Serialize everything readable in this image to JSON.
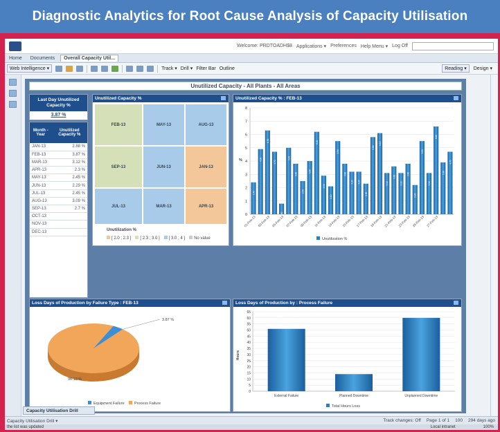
{
  "banner": {
    "title": "Diagnostic Analytics for Root Cause Analysis of Capacity Utilisation"
  },
  "topbar": {
    "welcome": "Welcome: PRDTOADH$8",
    "applications": "Applications ▾",
    "preferences": "Preferences",
    "help": "Help Menu ▾",
    "logoff": "Log Off"
  },
  "tabs": [
    {
      "label": "Home"
    },
    {
      "label": "Documents"
    },
    {
      "label": "Overall Capacity Util..."
    }
  ],
  "toolbar": {
    "nav": "Web Intelligence ▾",
    "track": "Track ▾",
    "drill": "Drill ▾",
    "filterbar": "Filter Bar",
    "outline": "Outline",
    "reading": "Reading ▾",
    "design": "Design ▾"
  },
  "report": {
    "title": "Unutilized Capacity - All Plants - All Areas"
  },
  "lastday": {
    "header": "Last Day Unutilized Capacity %",
    "value": "3.87 %"
  },
  "month_table": {
    "col_month": "Month - Year",
    "col_value": "Unutilized Capacity %",
    "rows": [
      {
        "month": "JAN-13",
        "value": "2.88 %"
      },
      {
        "month": "FEB-13",
        "value": "3.87 %"
      },
      {
        "month": "MAR-13",
        "value": "3.12 %"
      },
      {
        "month": "APR-13",
        "value": "2.3 %"
      },
      {
        "month": "MAY-13",
        "value": "2.45 %"
      },
      {
        "month": "JUN-13",
        "value": "2.29 %"
      },
      {
        "month": "JUL-13",
        "value": "2.45 %"
      },
      {
        "month": "AUG-13",
        "value": "3.09 %"
      },
      {
        "month": "SEP-13",
        "value": "2.7 %"
      },
      {
        "month": "OCT-13",
        "value": ""
      },
      {
        "month": "NOV-13",
        "value": ""
      },
      {
        "month": "DEC-13",
        "value": ""
      }
    ]
  },
  "heatmap": {
    "header": "Unutilized Capacity %",
    "cells": [
      "FEB-13",
      "MAY-13",
      "AUG-13",
      "SEP-13",
      "JUN-13",
      "JAN-13",
      "JUL-13",
      "MAR-13",
      "APR-13"
    ],
    "legend_title": "Unutilization %",
    "legend": [
      "[ 2.0 ; 2.3 ]",
      "[ 2.3 ; 3.0 ]",
      "[ 3.0 ; 4 ]",
      "No value"
    ],
    "colors": {
      "low": "#f4c79b",
      "mid": "#d6e0b8",
      "high": "#a9cbea",
      "none": "#cccccc"
    }
  },
  "bar_header": "Unutilized Capacity % : FEB-13",
  "bar_legend": "Unutilization %",
  "pie_header": "Loss Days of Production by Failure Type : FEB-13",
  "pie_legend": [
    "Equipment Failure",
    "Process Failure"
  ],
  "pie_labels": [
    "3.87 %",
    "96.13 %"
  ],
  "hours_header": "Loss Days of Production by : Process Failure",
  "hours_legend": "Total Hours Loss",
  "report_tab": "Capacity Utilisation Drill",
  "statusbar": {
    "left": "Capacity Utilisation Drill ▾",
    "track": "Track changes: Off",
    "page": "Page 1 of 1",
    "zoom": "100",
    "time": "294 days ago"
  },
  "winstatus": {
    "left": "the list was updated",
    "zone": "Local intranet",
    "zoom": "100%"
  },
  "chart_data": [
    {
      "type": "bar",
      "title": "Unutilized Capacity % : FEB-13",
      "ylabel": "%",
      "ylim": [
        0,
        8
      ],
      "yticks": [
        0,
        1,
        2,
        3,
        4,
        5,
        6,
        7,
        8
      ],
      "values": [
        2.4,
        4.9,
        6.3,
        4.7,
        0.8,
        5.0,
        3.8,
        2.5,
        4.0,
        6.2,
        2.9,
        2.1,
        5.5,
        3.8,
        3.2,
        3.2,
        2.3,
        5.8,
        6.1,
        3.1,
        3.6,
        3.1,
        3.8,
        2.2,
        5.5,
        3.1,
        6.6,
        3.9,
        4.7
      ],
      "xticks": [
        "01-Feb-13",
        "03-Feb-13",
        "05-Feb-13",
        "07-Feb-13",
        "09-Feb-13",
        "11-Feb-13",
        "13-Feb-13",
        "15-Feb-13",
        "17-Feb-13",
        "19-Feb-13",
        "21-Feb-13",
        "23-Feb-13",
        "25-Feb-13",
        "27-Feb-13"
      ],
      "series": [
        {
          "name": "Unutilization %"
        }
      ]
    },
    {
      "type": "pie",
      "title": "Loss Days of Production by Failure Type : FEB-13",
      "slices": [
        {
          "name": "Equipment Failure",
          "value": 3.87
        },
        {
          "name": "Process Failure",
          "value": 96.13
        }
      ]
    },
    {
      "type": "bar",
      "title": "Loss Days of Production by : Process Failure",
      "ylabel": "Hours",
      "ylim": [
        0,
        65
      ],
      "yticks": [
        0,
        5,
        10,
        15,
        20,
        25,
        30,
        35,
        40,
        45,
        50,
        55,
        60,
        65
      ],
      "categories": [
        "External Failure",
        "Planned Downtime",
        "Unplanned Downtime"
      ],
      "values": [
        51,
        14,
        60
      ],
      "series": [
        {
          "name": "Total Hours Loss"
        }
      ]
    }
  ]
}
